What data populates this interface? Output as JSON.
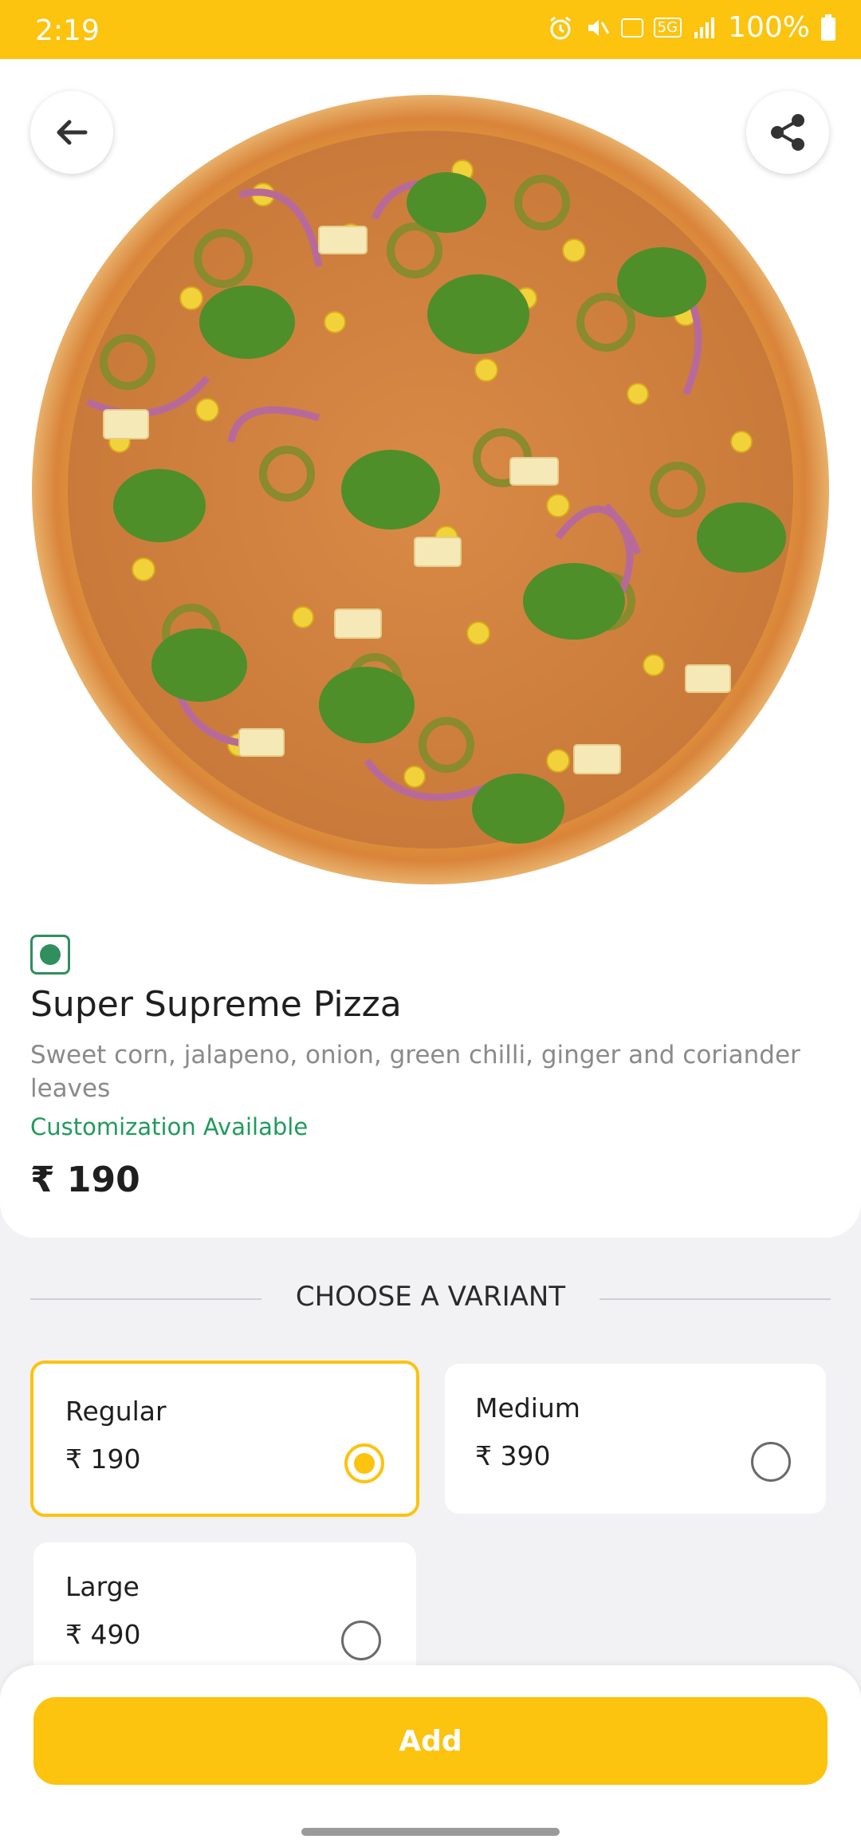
{
  "status_bar": {
    "time": "2:19",
    "network": "5G",
    "battery": "100%"
  },
  "product": {
    "name": "Super Supreme Pizza",
    "description": "Sweet corn, jalapeno, onion, green chilli, ginger and coriander leaves",
    "customization": "Customization Available",
    "price": "₹ 190",
    "veg": true
  },
  "variants_section": {
    "title": "CHOOSE A VARIANT",
    "options": [
      {
        "name": "Regular",
        "price": "₹ 190",
        "selected": true
      },
      {
        "name": "Medium",
        "price": "₹ 390",
        "selected": false
      },
      {
        "name": "Large",
        "price": "₹ 490",
        "selected": false
      }
    ]
  },
  "actions": {
    "add_label": "Add"
  },
  "icons": {
    "back": "arrow-left-icon",
    "share": "share-icon"
  },
  "colors": {
    "accent": "#fcc30f",
    "veg_green": "#2f8f5e",
    "customization_green": "#1f9b5c"
  }
}
